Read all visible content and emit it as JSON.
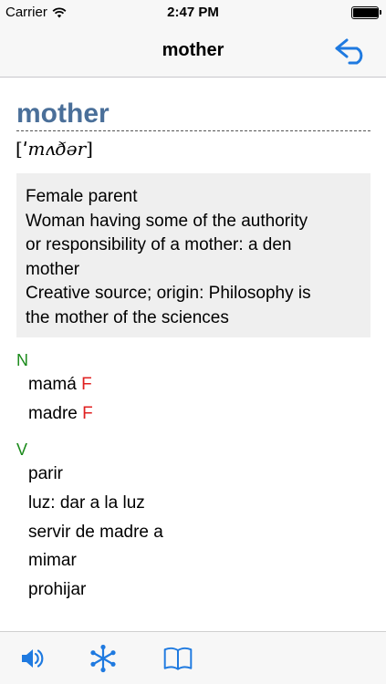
{
  "status_bar": {
    "carrier": "Carrier",
    "time": "2:47 PM",
    "battery_level": 0.95
  },
  "nav": {
    "title": "mother",
    "back_icon": "reply-arrow-icon",
    "accent_color": "#1f7ae0"
  },
  "entry": {
    "headword": "mother",
    "pronunciation": {
      "open": "[",
      "ipa": "ˈmʌðər",
      "close": "]"
    },
    "definitions": [
      "Female parent",
      "Woman having some of the authority",
      "or responsibility of a mother: a den",
      "mother",
      "Creative source; origin: Philosophy is",
      "the mother of the sciences"
    ],
    "groups": [
      {
        "pos": "N",
        "items": [
          {
            "word": "mamá",
            "gender": "F"
          },
          {
            "word": "madre",
            "gender": "F"
          }
        ]
      },
      {
        "pos": "V",
        "items": [
          {
            "word": "parir",
            "gender": ""
          },
          {
            "word": "luz: dar a la luz",
            "gender": ""
          },
          {
            "word": "servir de madre a",
            "gender": ""
          },
          {
            "word": "mimar",
            "gender": ""
          },
          {
            "word": "prohijar",
            "gender": ""
          }
        ]
      }
    ]
  },
  "toolbar": {
    "items": [
      "speaker-icon",
      "snowflake-icon",
      "book-icon"
    ]
  },
  "colors": {
    "headword": "#4a6f99",
    "pos": "#1a8a1a",
    "gender": "#e02020",
    "accent": "#1f7ae0"
  }
}
